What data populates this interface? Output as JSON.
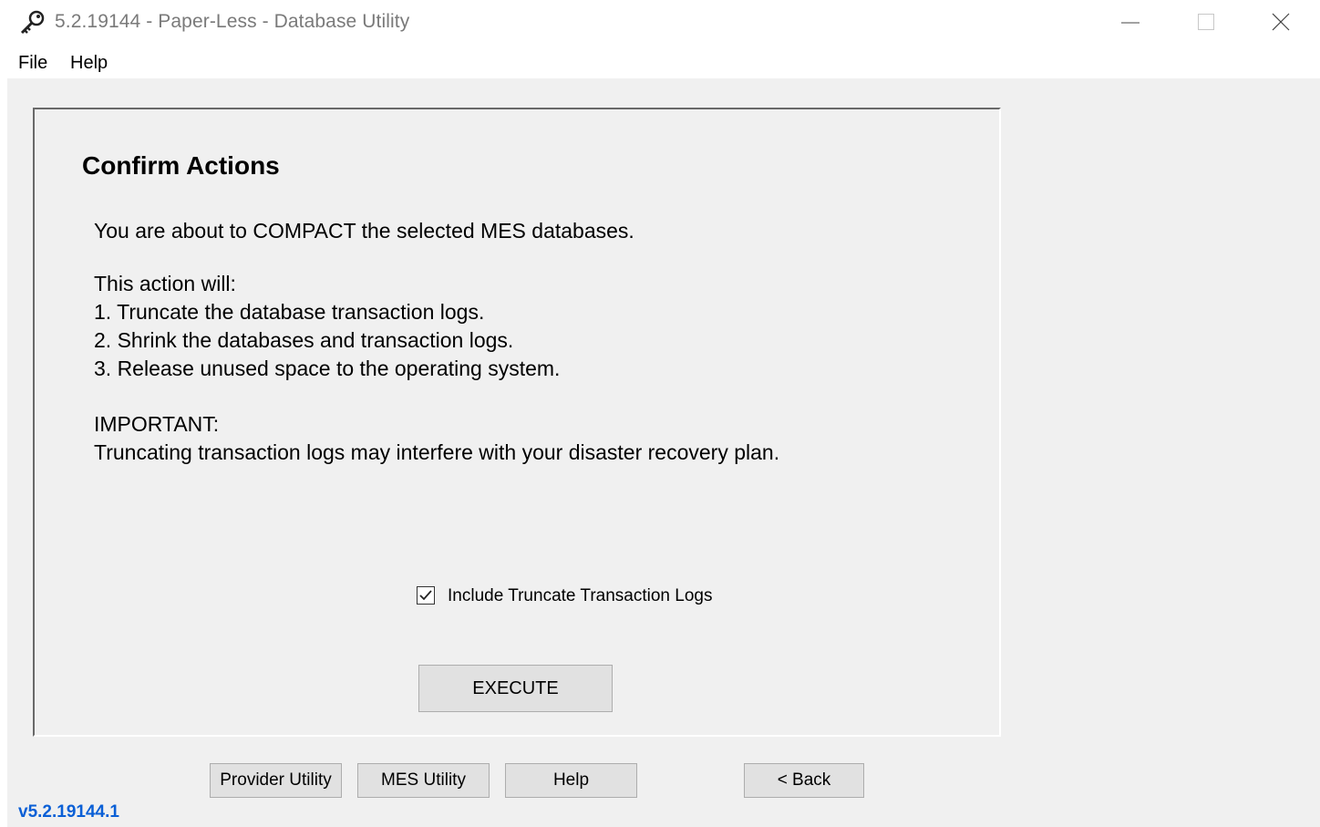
{
  "window": {
    "title": "5.2.19144 - Paper-Less - Database Utility",
    "icon": "key-icon"
  },
  "menu": {
    "file": "File",
    "help": "Help"
  },
  "panel": {
    "heading": "Confirm Actions",
    "intro": "You are about to COMPACT the selected MES databases.",
    "actions_title": "This action will:",
    "actions": [
      "1. Truncate the database transaction logs.",
      "2. Shrink the databases and transaction logs.",
      "3. Release unused space to the operating system."
    ],
    "important_title": "IMPORTANT:",
    "important_text": "Truncating transaction logs may interfere with your disaster recovery plan.",
    "checkbox_label": "Include Truncate Transaction Logs",
    "checkbox_checked": true,
    "execute_label": "EXECUTE"
  },
  "footer": {
    "provider_utility": "Provider Utility",
    "mes_utility": "MES Utility",
    "help": "Help",
    "back": "< Back",
    "version": "v5.2.19144.1"
  },
  "colors": {
    "client_bg": "#f0f0f0",
    "button_bg": "#e1e1e1",
    "version_text": "#0a5fd6"
  }
}
